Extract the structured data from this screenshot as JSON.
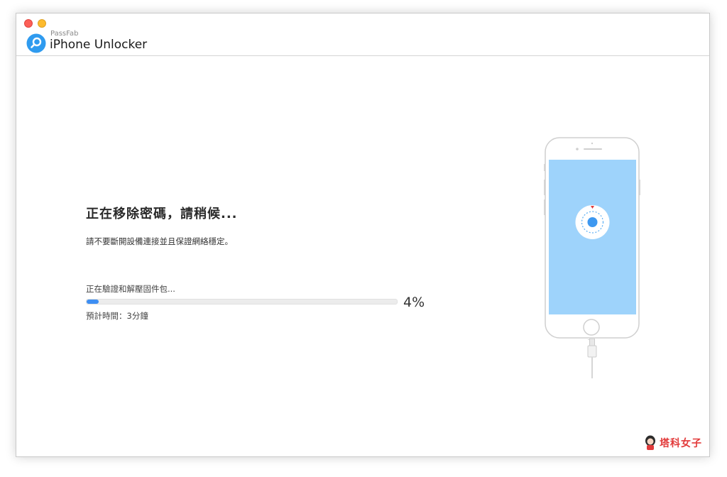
{
  "window": {
    "vendor": "PassFab",
    "app_name": "iPhone Unlocker",
    "controls": [
      "close",
      "minimize"
    ]
  },
  "status": {
    "title": "正在移除密碼，請稍候...",
    "note": "請不要斷開設備連接並且保證網絡穩定。"
  },
  "progress": {
    "label": "正在驗證和解壓固件包...",
    "percent": 4,
    "percent_text": "4%",
    "eta": "預計時間：3分鐘"
  },
  "device": {
    "screen_color": "#9ed3fb",
    "icon": "unlock-dial-icon"
  },
  "watermark": {
    "text": "塔科女子"
  },
  "colors": {
    "accent": "#3d8ef3",
    "logo": "#2f9bef",
    "watermark": "#e23a3a"
  }
}
